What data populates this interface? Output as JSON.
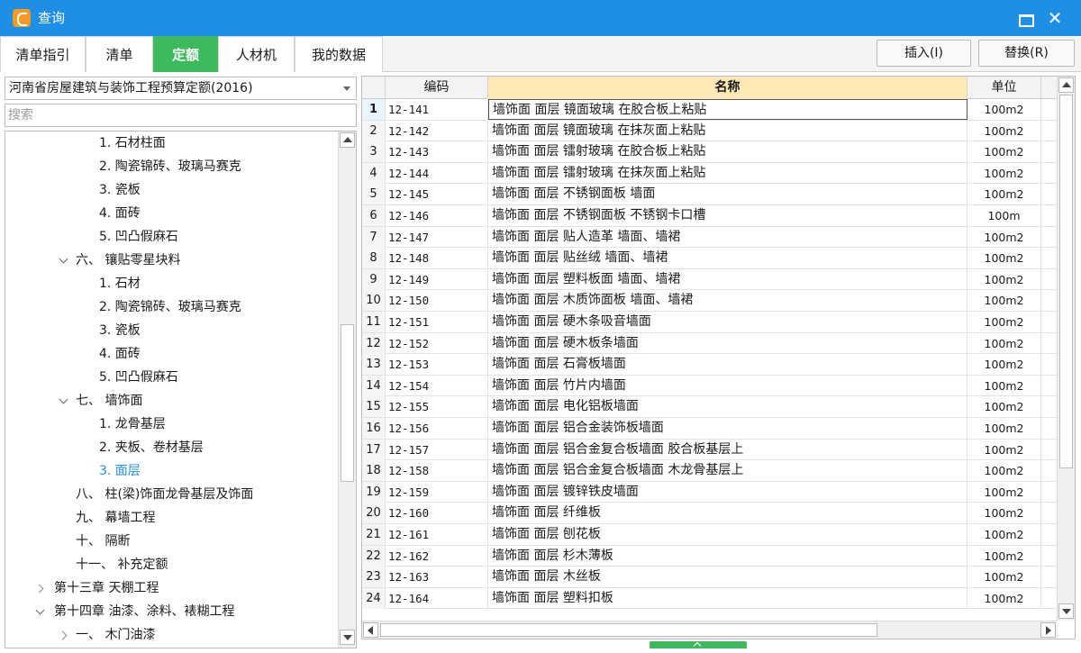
{
  "window": {
    "title": "查询",
    "maximize_icon": "maximize-icon",
    "close_icon": "close-icon"
  },
  "tabs": [
    {
      "label": "清单指引"
    },
    {
      "label": "清单"
    },
    {
      "label": "定额",
      "active": true
    },
    {
      "label": "人材机"
    },
    {
      "label": "我的数据"
    }
  ],
  "toolbar": {
    "insert_label": "插入(I)",
    "replace_label": "替换(R)"
  },
  "left": {
    "selected_norm": "河南省房屋建筑与装饰工程预算定额(2016)",
    "search_placeholder": "搜索",
    "tree": [
      {
        "label": "1. 石材柱面",
        "level": 3
      },
      {
        "label": "2. 陶瓷锦砖、玻璃马赛克",
        "level": 3
      },
      {
        "label": "3. 瓷板",
        "level": 3
      },
      {
        "label": "4. 面砖",
        "level": 3
      },
      {
        "label": "5. 凹凸假麻石",
        "level": 3
      },
      {
        "label": "六、 镶贴零星块料",
        "level": 2,
        "expander": "down"
      },
      {
        "label": "1. 石材",
        "level": 3
      },
      {
        "label": "2. 陶瓷锦砖、玻璃马赛克",
        "level": 3
      },
      {
        "label": "3. 瓷板",
        "level": 3
      },
      {
        "label": "4. 面砖",
        "level": 3
      },
      {
        "label": "5. 凹凸假麻石",
        "level": 3
      },
      {
        "label": "七、 墙饰面",
        "level": 2,
        "expander": "down"
      },
      {
        "label": "1. 龙骨基层",
        "level": 3
      },
      {
        "label": "2. 夹板、卷材基层",
        "level": 3
      },
      {
        "label": "3. 面层",
        "level": 3,
        "selected": true
      },
      {
        "label": "八、 柱(梁)饰面龙骨基层及饰面",
        "level": 2
      },
      {
        "label": "九、 幕墙工程",
        "level": 2
      },
      {
        "label": "十、 隔断",
        "level": 2
      },
      {
        "label": "十一、 补充定额",
        "level": 2
      },
      {
        "label": "第十三章 天棚工程",
        "level": 1,
        "expander": "right"
      },
      {
        "label": "第十四章 油漆、涂料、裱糊工程",
        "level": 1,
        "expander": "down"
      },
      {
        "label": "一、 木门油漆",
        "level": 2,
        "expander": "right"
      }
    ]
  },
  "grid": {
    "columns": {
      "code": "编码",
      "name": "名称",
      "unit": "单位"
    },
    "rows": [
      {
        "idx": "1",
        "code": "12-141",
        "name": "墙饰面 面层 镜面玻璃 在胶合板上粘贴",
        "unit": "100m2"
      },
      {
        "idx": "2",
        "code": "12-142",
        "name": "墙饰面 面层 镜面玻璃 在抹灰面上粘贴",
        "unit": "100m2"
      },
      {
        "idx": "3",
        "code": "12-143",
        "name": "墙饰面 面层 镭射玻璃 在胶合板上粘贴",
        "unit": "100m2"
      },
      {
        "idx": "4",
        "code": "12-144",
        "name": "墙饰面 面层 镭射玻璃 在抹灰面上粘贴",
        "unit": "100m2"
      },
      {
        "idx": "5",
        "code": "12-145",
        "name": "墙饰面 面层 不锈钢面板 墙面",
        "unit": "100m2"
      },
      {
        "idx": "6",
        "code": "12-146",
        "name": "墙饰面 面层 不锈钢面板 不锈钢卡口槽",
        "unit": "100m"
      },
      {
        "idx": "7",
        "code": "12-147",
        "name": "墙饰面 面层 贴人造革 墙面、墙裙",
        "unit": "100m2"
      },
      {
        "idx": "8",
        "code": "12-148",
        "name": "墙饰面 面层 贴丝绒 墙面、墙裙",
        "unit": "100m2"
      },
      {
        "idx": "9",
        "code": "12-149",
        "name": "墙饰面 面层 塑料板面 墙面、墙裙",
        "unit": "100m2"
      },
      {
        "idx": "10",
        "code": "12-150",
        "name": "墙饰面 面层 木质饰面板 墙面、墙裙",
        "unit": "100m2"
      },
      {
        "idx": "11",
        "code": "12-151",
        "name": "墙饰面 面层 硬木条吸音墙面",
        "unit": "100m2"
      },
      {
        "idx": "12",
        "code": "12-152",
        "name": "墙饰面 面层 硬木板条墙面",
        "unit": "100m2"
      },
      {
        "idx": "13",
        "code": "12-153",
        "name": "墙饰面 面层 石膏板墙面",
        "unit": "100m2"
      },
      {
        "idx": "14",
        "code": "12-154",
        "name": "墙饰面 面层 竹片内墙面",
        "unit": "100m2"
      },
      {
        "idx": "15",
        "code": "12-155",
        "name": "墙饰面 面层 电化铝板墙面",
        "unit": "100m2"
      },
      {
        "idx": "16",
        "code": "12-156",
        "name": "墙饰面 面层 铝合金装饰板墙面",
        "unit": "100m2"
      },
      {
        "idx": "17",
        "code": "12-157",
        "name": "墙饰面 面层 铝合金复合板墙面 胶合板基层上",
        "unit": "100m2"
      },
      {
        "idx": "18",
        "code": "12-158",
        "name": "墙饰面 面层 铝合金复合板墙面 木龙骨基层上",
        "unit": "100m2"
      },
      {
        "idx": "19",
        "code": "12-159",
        "name": "墙饰面 面层 镀锌铁皮墙面",
        "unit": "100m2"
      },
      {
        "idx": "20",
        "code": "12-160",
        "name": "墙饰面 面层 纤维板",
        "unit": "100m2"
      },
      {
        "idx": "21",
        "code": "12-161",
        "name": "墙饰面 面层 刨花板",
        "unit": "100m2"
      },
      {
        "idx": "22",
        "code": "12-162",
        "name": "墙饰面 面层 杉木薄板",
        "unit": "100m2"
      },
      {
        "idx": "23",
        "code": "12-163",
        "name": "墙饰面 面层 木丝板",
        "unit": "100m2"
      },
      {
        "idx": "24",
        "code": "12-164",
        "name": "墙饰面 面层 塑料扣板",
        "unit": "100m2"
      }
    ]
  }
}
